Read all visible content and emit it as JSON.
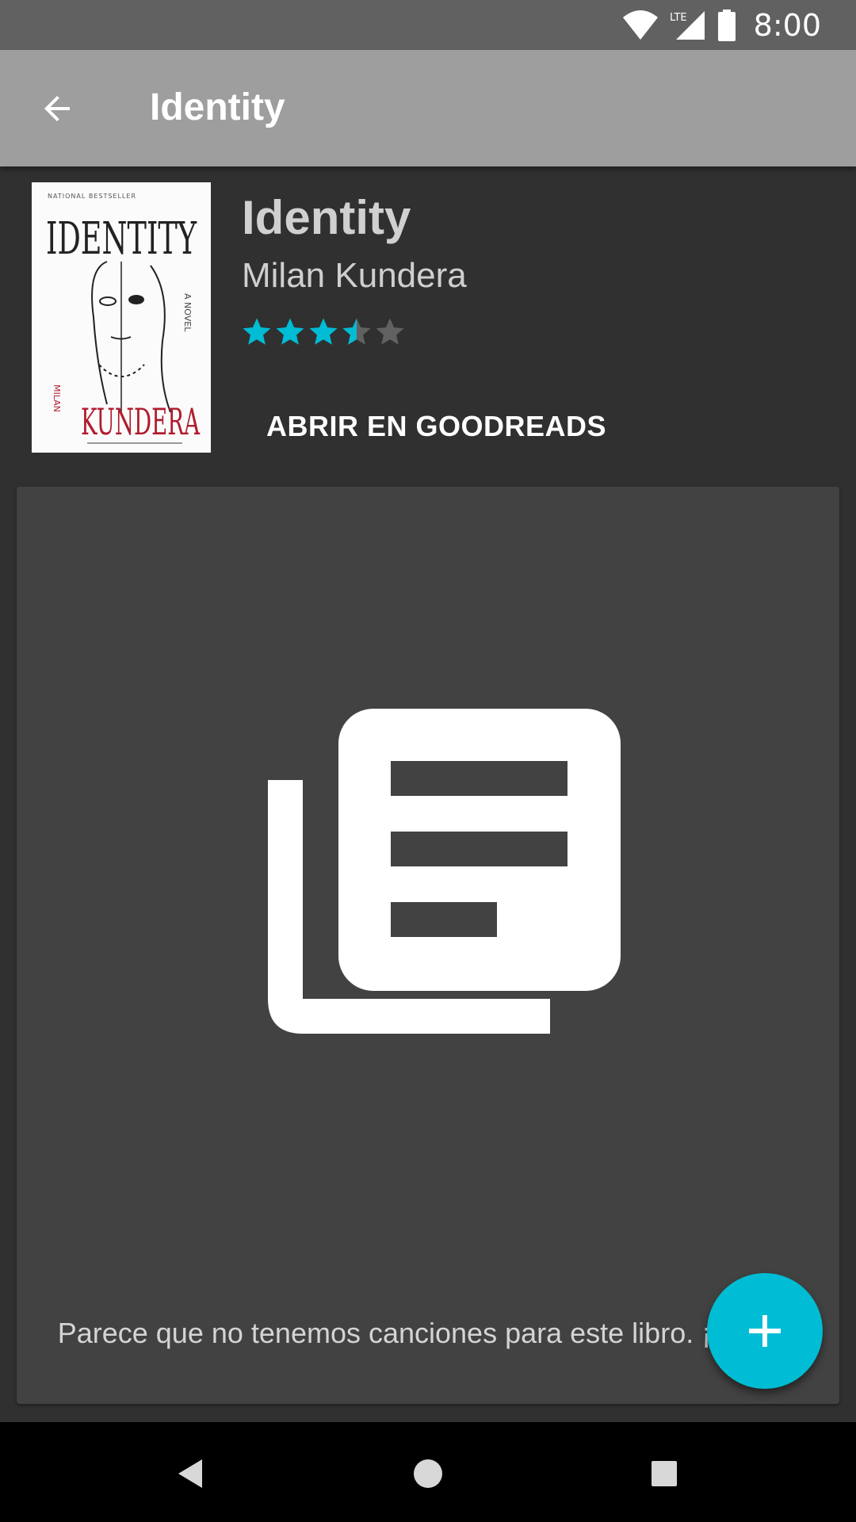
{
  "status_bar": {
    "network": "LTE",
    "time": "8:00"
  },
  "app_bar": {
    "title": "Identity",
    "back_icon": "arrow-back-icon"
  },
  "book": {
    "title": "Identity",
    "author": "Milan Kundera",
    "rating": 3.5,
    "rating_max": 5,
    "open_button_label": "ABRIR EN GOODREADS",
    "cover": {
      "top_banner": "NATIONAL BESTSELLER",
      "title": "IDENTITY",
      "side_text": "A NOVEL",
      "author_first": "MILAN",
      "author_last": "KUNDERA"
    }
  },
  "empty_state": {
    "icon": "library-books-icon",
    "message": "Parece que no tenemos canciones para este libro. ¡A tuya!"
  },
  "fab": {
    "icon": "add-icon"
  },
  "colors": {
    "accent": "#00bcd4",
    "background": "#303030",
    "card": "#424242",
    "app_bar": "#9e9e9e",
    "status_bar": "#616161",
    "star_empty": "#616161"
  }
}
